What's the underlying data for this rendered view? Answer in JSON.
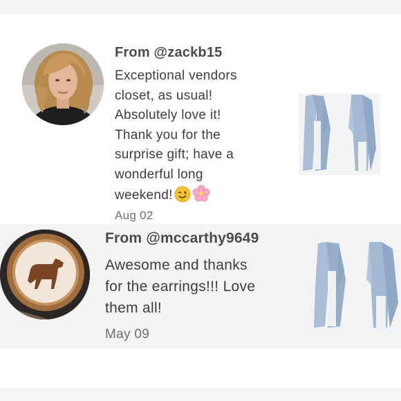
{
  "reviews": [
    {
      "from": "From @zackb15",
      "lines": [
        "Exceptional vendors",
        "closet, as usual!",
        "Absolutely love it!",
        "Thank you for the",
        "surprise gift; have a",
        "wonderful long",
        "weekend!"
      ],
      "emojis": [
        "winking-face-emoji",
        "cherry-blossom-emoji"
      ],
      "date": "Aug 02",
      "avatar": "woman-portrait-photo",
      "product": "blue-cardigan-photo"
    },
    {
      "from": "From @mccarthy9649",
      "lines": [
        "Awesome and thanks",
        "for the earrings!!! Love",
        "them all!"
      ],
      "date": "May 09",
      "avatar": "latte-art-dog-photo",
      "product": "blue-cardigan-photo"
    }
  ],
  "colors": {
    "row_alt_background": "#f4f4f4",
    "cardigan": "#9fb6d0",
    "text": "#3d3d3d"
  }
}
